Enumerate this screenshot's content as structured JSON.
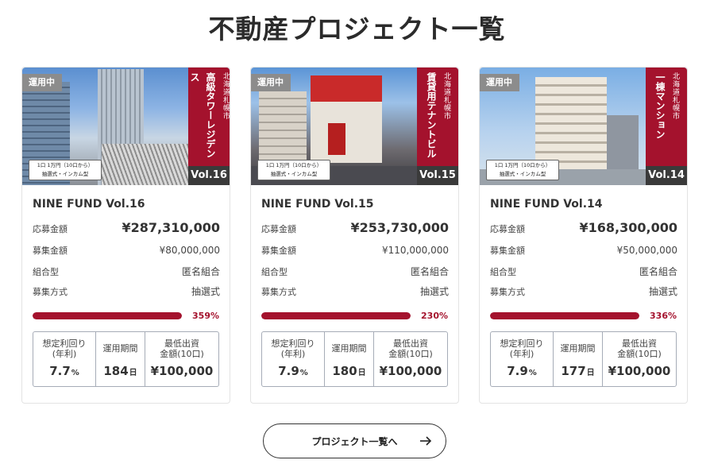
{
  "page": {
    "title": "不動産プロジェクト一覧"
  },
  "labels": {
    "amount_applied": "応募金額",
    "amount_target": "募集金額",
    "structure": "組合型",
    "method": "募集方式",
    "yield": "想定利回り\n(年利)",
    "period": "運用期間",
    "min_invest": "最低出資\n金額(10口)",
    "period_unit": "日",
    "yield_unit": "%"
  },
  "cards": [
    {
      "status": "運用中",
      "region": "北海道札幌市",
      "type": "高級タワーレジデンス",
      "vol_tag": "Vol.16",
      "lottery_line1": "1口 1万円（10口から）",
      "lottery_line2": "抽選式・インカム型",
      "name": "NINE FUND Vol.16",
      "applied": "¥287,310,000",
      "target": "¥80,000,000",
      "structure": "匿名組合",
      "method": "抽選式",
      "progress_label": "359%",
      "progress_fraction": 1.0,
      "yield": "7.7",
      "period": "184",
      "min_invest": "¥100,000"
    },
    {
      "status": "運用中",
      "region": "北海道札幌市",
      "type": "賃貸用テナントビル",
      "vol_tag": "Vol.15",
      "lottery_line1": "1口 1万円（10口から）",
      "lottery_line2": "抽選式・インカム型",
      "name": "NINE FUND Vol.15",
      "applied": "¥253,730,000",
      "target": "¥110,000,000",
      "structure": "匿名組合",
      "method": "抽選式",
      "progress_label": "230%",
      "progress_fraction": 1.0,
      "yield": "7.9",
      "period": "180",
      "min_invest": "¥100,000"
    },
    {
      "status": "運用中",
      "region": "北海道札幌市",
      "type": "一棟マンション",
      "vol_tag": "Vol.14",
      "lottery_line1": "1口 1万円（10口から）",
      "lottery_line2": "抽選式・インカム型",
      "name": "NINE FUND Vol.14",
      "applied": "¥168,300,000",
      "target": "¥50,000,000",
      "structure": "匿名組合",
      "method": "抽選式",
      "progress_label": "336%",
      "progress_fraction": 1.0,
      "yield": "7.9",
      "period": "177",
      "min_invest": "¥100,000"
    }
  ],
  "button": {
    "label": "プロジェクト一覧へ",
    "icon": "arrow-right-icon"
  },
  "colors": {
    "accent": "#a4122d",
    "badge": "#8c8c8c",
    "vol_tag": "#3a3a3a"
  }
}
